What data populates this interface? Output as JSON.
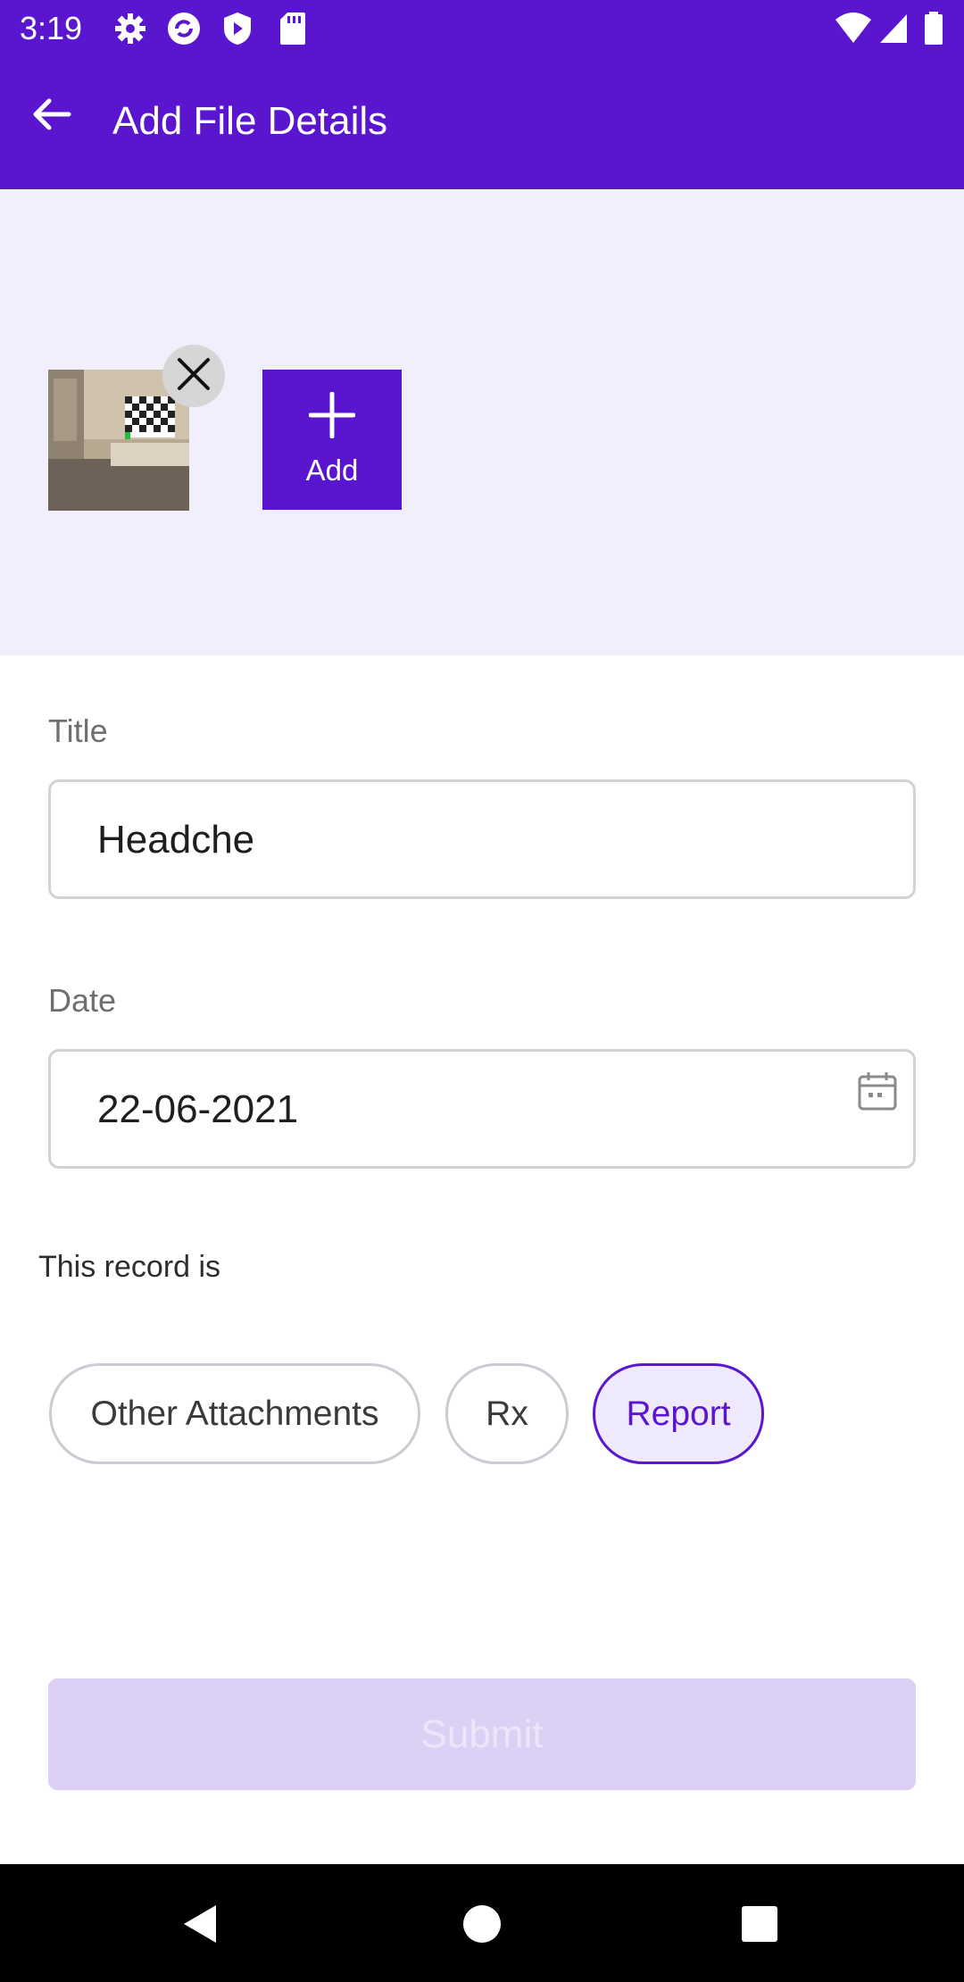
{
  "status_bar": {
    "time": "3:19",
    "left_icons": [
      "gear-icon",
      "sync-icon",
      "shield-icon",
      "sd-card-icon"
    ],
    "right_icons": [
      "wifi-icon",
      "signal-icon",
      "battery-icon"
    ]
  },
  "app_bar": {
    "back_icon": "arrow-left-icon",
    "title": "Add File Details"
  },
  "attachments": {
    "remove_icon": "close-icon",
    "add_label": "Add",
    "add_icon": "plus-icon"
  },
  "form": {
    "title_label": "Title",
    "title_value": "Headche",
    "date_label": "Date",
    "date_value": "22-06-2021",
    "date_icon": "calendar-icon",
    "record_label": "This record is",
    "chips": [
      {
        "label": "Other Attachments",
        "selected": false
      },
      {
        "label": "Rx",
        "selected": false
      },
      {
        "label": "Report",
        "selected": true
      }
    ],
    "submit_label": "Submit"
  },
  "colors": {
    "primary": "#5a16cf",
    "attach_bg": "#f2effc",
    "submit_disabled_bg": "#ddd0f5",
    "chip_selected_bg": "#efe9fd"
  },
  "nav_bar": {
    "icons": [
      "back-triangle-icon",
      "home-circle-icon",
      "recents-square-icon"
    ]
  }
}
